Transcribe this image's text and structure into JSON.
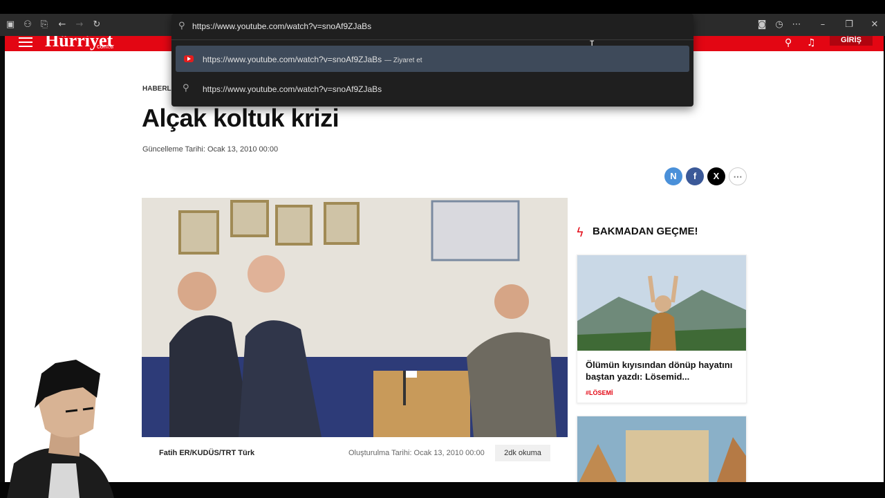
{
  "browser": {
    "address": "https://www.youtube.com/watch?v=snoAf9ZJaBs",
    "suggestions": [
      {
        "text": "https://www.youtube.com/watch?v=snoAf9ZJaBs",
        "hint": "— Ziyaret et",
        "icon": "youtube-icon"
      },
      {
        "text": "https://www.youtube.com/watch?v=snoAf9ZJaBs",
        "icon": "search-icon"
      }
    ]
  },
  "site": {
    "logo": "Hürriyet",
    "logo_sub": "com.tr",
    "login": "GİRİŞ",
    "brand_color": "#e30613"
  },
  "article": {
    "breadcrumb": "HABERLER",
    "title": "Alçak koltuk krizi",
    "updated": "Güncelleme Tarihi: Ocak 13, 2010 00:00",
    "byline": "Fatih ER/KUDÜS/TRT Türk",
    "created": "Oluşturulma Tarihi: Ocak 13, 2010 00:00",
    "read_time": "2dk okuma"
  },
  "share": [
    {
      "label": "N",
      "color": "#4a90d9"
    },
    {
      "label": "f",
      "color": "#3b5998"
    },
    {
      "label": "X",
      "color": "#000000"
    },
    {
      "label": "⋯",
      "color": "#ffffff"
    }
  ],
  "sidebar": {
    "heading": "BAKMADAN GEÇME!",
    "cards": [
      {
        "title": "Ölümün kıyısından dönüp hayatını baştan yazdı: Lösemid...",
        "tag": "#LÖSEMİ"
      }
    ]
  }
}
